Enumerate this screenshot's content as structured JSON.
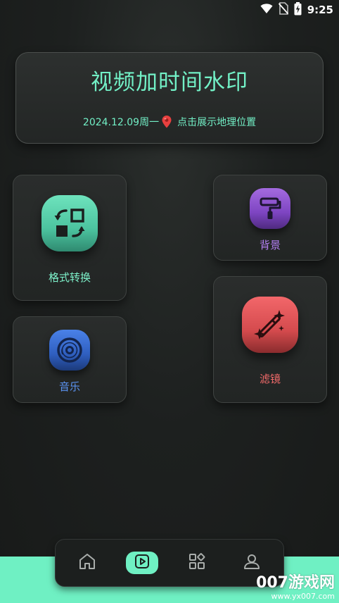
{
  "status_bar": {
    "time": "9:25",
    "icons": [
      "wifi-icon",
      "no-sim-icon",
      "battery-charging-icon"
    ]
  },
  "header": {
    "title": "视频加时间水印",
    "date_weekday": "2024.12.09周一",
    "location_text": "点击展示地理位置",
    "pin_icon": "location-pin-icon",
    "accent_color": "#72f0c6"
  },
  "tiles": {
    "format_convert": {
      "label": "格式转换",
      "icon": "format-convert-icon",
      "color": "#7ef2cb"
    },
    "background": {
      "label": "背景",
      "icon": "paint-roller-icon",
      "color": "#b27ef0"
    },
    "music": {
      "label": "音乐",
      "icon": "music-disc-icon",
      "color": "#5b94f2"
    },
    "filter": {
      "label": "滤镜",
      "icon": "magic-wand-icon",
      "color": "#f26a6a"
    }
  },
  "bottom_nav": {
    "items": [
      {
        "icon": "home-icon",
        "active": false
      },
      {
        "icon": "video-play-icon",
        "active": true
      },
      {
        "icon": "apps-grid-icon",
        "active": false
      },
      {
        "icon": "profile-icon",
        "active": false
      }
    ],
    "active_color": "#6ff0c3"
  },
  "watermark": {
    "main": "007游戏网",
    "url": "www.yx007.com"
  }
}
